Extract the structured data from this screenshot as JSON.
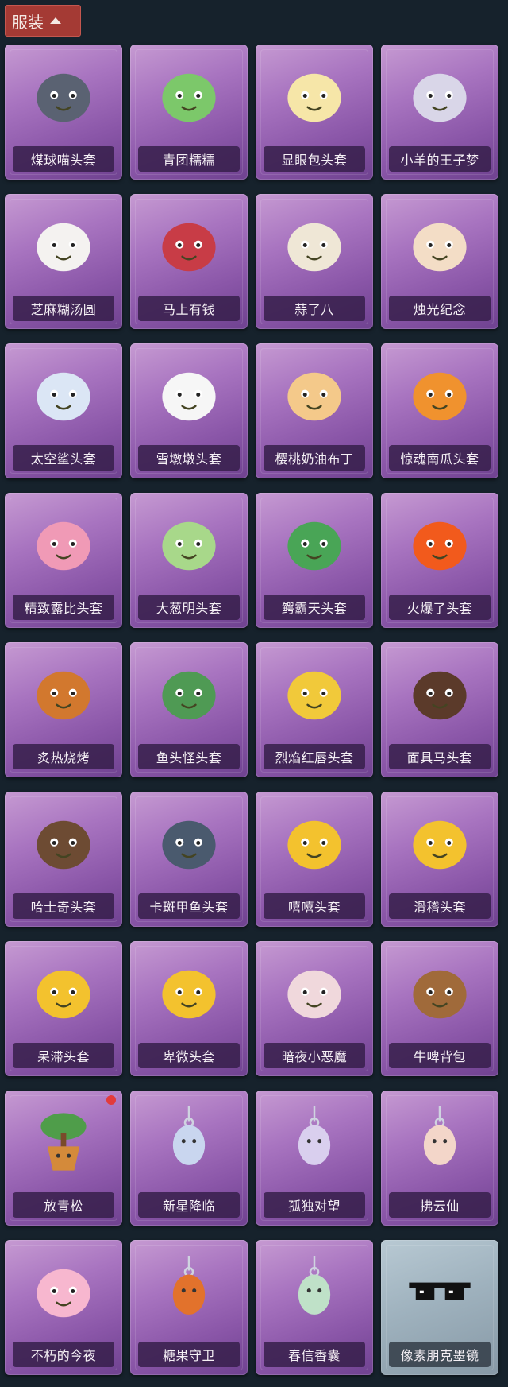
{
  "header": {
    "title": "服装",
    "icon": "chevron-up-icon"
  },
  "items": [
    {
      "label": "煤球喵头套",
      "icon": "cat-head-icon",
      "color": "#5a6272"
    },
    {
      "label": "青团糯糯",
      "icon": "green-dumpling-icon",
      "color": "#7cc86a"
    },
    {
      "label": "显眼包头套",
      "icon": "lightbulb-head-icon",
      "color": "#f6e6a8"
    },
    {
      "label": "小羊的王子梦",
      "icon": "sheep-prince-icon",
      "color": "#d9d6e8"
    },
    {
      "label": "芝麻糊汤圆",
      "icon": "rice-ball-icon",
      "color": "#f4f2f0"
    },
    {
      "label": "马上有钱",
      "icon": "red-horse-icon",
      "color": "#c83c46"
    },
    {
      "label": "蒜了八",
      "icon": "garlic-icon",
      "color": "#efe7d6"
    },
    {
      "label": "烛光纪念",
      "icon": "candle-icon",
      "color": "#f3ddc6"
    },
    {
      "label": "太空鲨头套",
      "icon": "space-shark-icon",
      "color": "#dbe6f5"
    },
    {
      "label": "雪墩墩头套",
      "icon": "snowman-icon",
      "color": "#f6f6f6"
    },
    {
      "label": "樱桃奶油布丁",
      "icon": "pudding-icon",
      "color": "#f4c98a"
    },
    {
      "label": "惊魂南瓜头套",
      "icon": "pumpkin-icon",
      "color": "#f0922e"
    },
    {
      "label": "精致露比头套",
      "icon": "pink-beaver-icon",
      "color": "#f09ab6"
    },
    {
      "label": "大葱明头套",
      "icon": "scallion-icon",
      "color": "#a8d88a"
    },
    {
      "label": "鳄霸天头套",
      "icon": "crocodile-icon",
      "color": "#49a556"
    },
    {
      "label": "火爆了头套",
      "icon": "fireball-icon",
      "color": "#f25a1c"
    },
    {
      "label": "炙热烧烤",
      "icon": "bbq-meat-icon",
      "color": "#d2782e"
    },
    {
      "label": "鱼头怪头套",
      "icon": "fish-head-icon",
      "color": "#4f9a54"
    },
    {
      "label": "烈焰红唇头套",
      "icon": "yellow-mouse-icon",
      "color": "#f1c93a"
    },
    {
      "label": "面具马头套",
      "icon": "horse-mask-icon",
      "color": "#5b3a2a"
    },
    {
      "label": "哈士奇头套",
      "icon": "husky-icon",
      "color": "#6d4b33"
    },
    {
      "label": "卡斑甲鱼头套",
      "icon": "armored-fish-icon",
      "color": "#4a5a6e"
    },
    {
      "label": "嘻嘻头套",
      "icon": "grin-emoji-icon",
      "color": "#f3c22e"
    },
    {
      "label": "滑稽头套",
      "icon": "sly-emoji-icon",
      "color": "#f3c22e"
    },
    {
      "label": "呆滞头套",
      "icon": "stunned-emoji-icon",
      "color": "#f3c22e"
    },
    {
      "label": "卑微头套",
      "icon": "humble-emoji-icon",
      "color": "#f3c22e"
    },
    {
      "label": "暗夜小恶魔",
      "icon": "little-devil-icon",
      "color": "#f0d8dc"
    },
    {
      "label": "牛啤背包",
      "icon": "cow-beer-backpack-icon",
      "color": "#a06a3a"
    },
    {
      "label": "放青松",
      "icon": "bonsai-pot-icon",
      "color": "#4f9d4a"
    },
    {
      "label": "新星降临",
      "icon": "keychain-doll-icon",
      "color": "#c9d6ef"
    },
    {
      "label": "孤独对望",
      "icon": "keychain-doll-icon",
      "color": "#d9cfee"
    },
    {
      "label": "拂云仙",
      "icon": "keychain-doll-icon",
      "color": "#f3d6c9"
    },
    {
      "label": "不朽的今夜",
      "icon": "pink-fox-bowl-icon",
      "color": "#f7b7cf"
    },
    {
      "label": "糖果守卫",
      "icon": "pumpkin-keychain-icon",
      "color": "#e2722c"
    },
    {
      "label": "春信香囊",
      "icon": "sachet-icon",
      "color": "#bfe1c8"
    },
    {
      "label": "像素朋克墨镜",
      "icon": "pixel-sunglasses-icon",
      "color": "#111111"
    }
  ]
}
